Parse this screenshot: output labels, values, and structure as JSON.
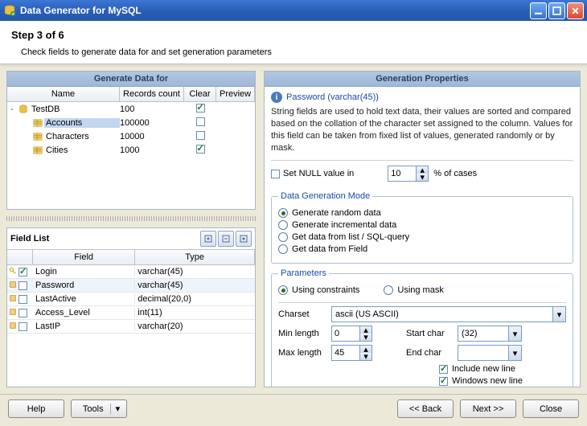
{
  "window": {
    "title": "Data Generator for MySQL"
  },
  "step": {
    "label": "Step 3 of 6",
    "desc": "Check fields to generate data for and set generation parameters"
  },
  "left_panel_title": "Generate Data for",
  "tree_headers": {
    "name": "Name",
    "records": "Records count",
    "clear": "Clear",
    "preview": "Preview"
  },
  "tree": [
    {
      "kind": "db",
      "label": "TestDB",
      "records": "100",
      "clear": true,
      "depth": 0,
      "expand": "-"
    },
    {
      "kind": "table",
      "label": "Accounts",
      "records": "100000",
      "clear": false,
      "depth": 1,
      "selected": true
    },
    {
      "kind": "table",
      "label": "Characters",
      "records": "10000",
      "clear": false,
      "depth": 1
    },
    {
      "kind": "table",
      "label": "Cities",
      "records": "1000",
      "clear": true,
      "depth": 1
    }
  ],
  "fieldlist": {
    "title": "Field List",
    "headers": {
      "field": "Field",
      "type": "Type"
    },
    "rows": [
      {
        "key": true,
        "checked": true,
        "field": "Login",
        "type": "varchar(45)",
        "active": false
      },
      {
        "key": false,
        "checked": false,
        "field": "Password",
        "type": "varchar(45)",
        "active": true
      },
      {
        "key": false,
        "checked": false,
        "field": "LastActive",
        "type": "decimal(20,0)",
        "active": false
      },
      {
        "key": false,
        "checked": false,
        "field": "Access_Level",
        "type": "int(11)",
        "active": false
      },
      {
        "key": false,
        "checked": false,
        "field": "LastIP",
        "type": "varchar(20)",
        "active": false
      }
    ]
  },
  "gp": {
    "title": "Generation Properties",
    "field_title": "Password (varchar(45))",
    "desc": "String fields are used to hold text data, their values are sorted and compared based on the collation of the character set assigned to the column. Values for this field can be taken from fixed list of values, generated randomly or by mask.",
    "null_label": "Set NULL value in",
    "null_value": "10",
    "null_suffix": "% of cases",
    "mode_legend": "Data Generation Mode",
    "modes": [
      {
        "label": "Generate random data",
        "on": true
      },
      {
        "label": "Generate incremental data",
        "on": false
      },
      {
        "label": "Get data from list / SQL-query",
        "on": false
      },
      {
        "label": "Get data from Field",
        "on": false
      }
    ],
    "params_legend": "Parameters",
    "param_subs": [
      {
        "label": "Using constraints",
        "on": true
      },
      {
        "label": "Using mask",
        "on": false
      }
    ],
    "charset_label": "Charset",
    "charset_value": "ascii (US ASCII)",
    "minlen_label": "Min length",
    "minlen_value": "0",
    "maxlen_label": "Max length",
    "maxlen_value": "45",
    "startchar_label": "Start char",
    "startchar_value": "(32)",
    "endchar_label": "End char",
    "endchar_value": "",
    "incl_newline": "Include new line",
    "win_newline": "Windows new line"
  },
  "buttons": {
    "help": "Help",
    "tools": "Tools",
    "back": "<< Back",
    "next": "Next >>",
    "close": "Close"
  }
}
